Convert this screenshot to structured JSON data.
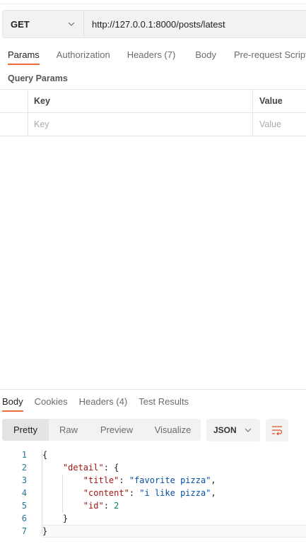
{
  "request": {
    "method": "GET",
    "url": "http://127.0.0.1:8000/posts/latest"
  },
  "request_tabs": [
    "Params",
    "Authorization",
    "Headers (7)",
    "Body",
    "Pre-request Script"
  ],
  "query_params": {
    "title": "Query Params",
    "columns": [
      "Key",
      "Value"
    ],
    "placeholders": [
      "Key",
      "Value"
    ]
  },
  "response_tabs": [
    "Body",
    "Cookies",
    "Headers (4)",
    "Test Results"
  ],
  "view_modes": [
    "Pretty",
    "Raw",
    "Preview",
    "Visualize"
  ],
  "format": "JSON",
  "code_lines": [
    [
      {
        "t": "{",
        "c": "p"
      }
    ],
    [
      {
        "t": "    ",
        "c": "p"
      },
      {
        "t": "\"detail\"",
        "c": "k"
      },
      {
        "t": ": {",
        "c": "p"
      }
    ],
    [
      {
        "t": "        ",
        "c": "p"
      },
      {
        "t": "\"title\"",
        "c": "k"
      },
      {
        "t": ": ",
        "c": "p"
      },
      {
        "t": "\"favorite pizza\"",
        "c": "s"
      },
      {
        "t": ",",
        "c": "p"
      }
    ],
    [
      {
        "t": "        ",
        "c": "p"
      },
      {
        "t": "\"content\"",
        "c": "k"
      },
      {
        "t": ": ",
        "c": "p"
      },
      {
        "t": "\"i like pizza\"",
        "c": "s"
      },
      {
        "t": ",",
        "c": "p"
      }
    ],
    [
      {
        "t": "        ",
        "c": "p"
      },
      {
        "t": "\"id\"",
        "c": "k"
      },
      {
        "t": ": ",
        "c": "p"
      },
      {
        "t": "2",
        "c": "n"
      }
    ],
    [
      {
        "t": "    }",
        "c": "p"
      }
    ],
    [
      {
        "t": "}",
        "c": "p"
      }
    ]
  ],
  "colors": {
    "accent": "#f26b3a",
    "key": "#a31515",
    "string": "#0451a5",
    "number": "#098658"
  }
}
